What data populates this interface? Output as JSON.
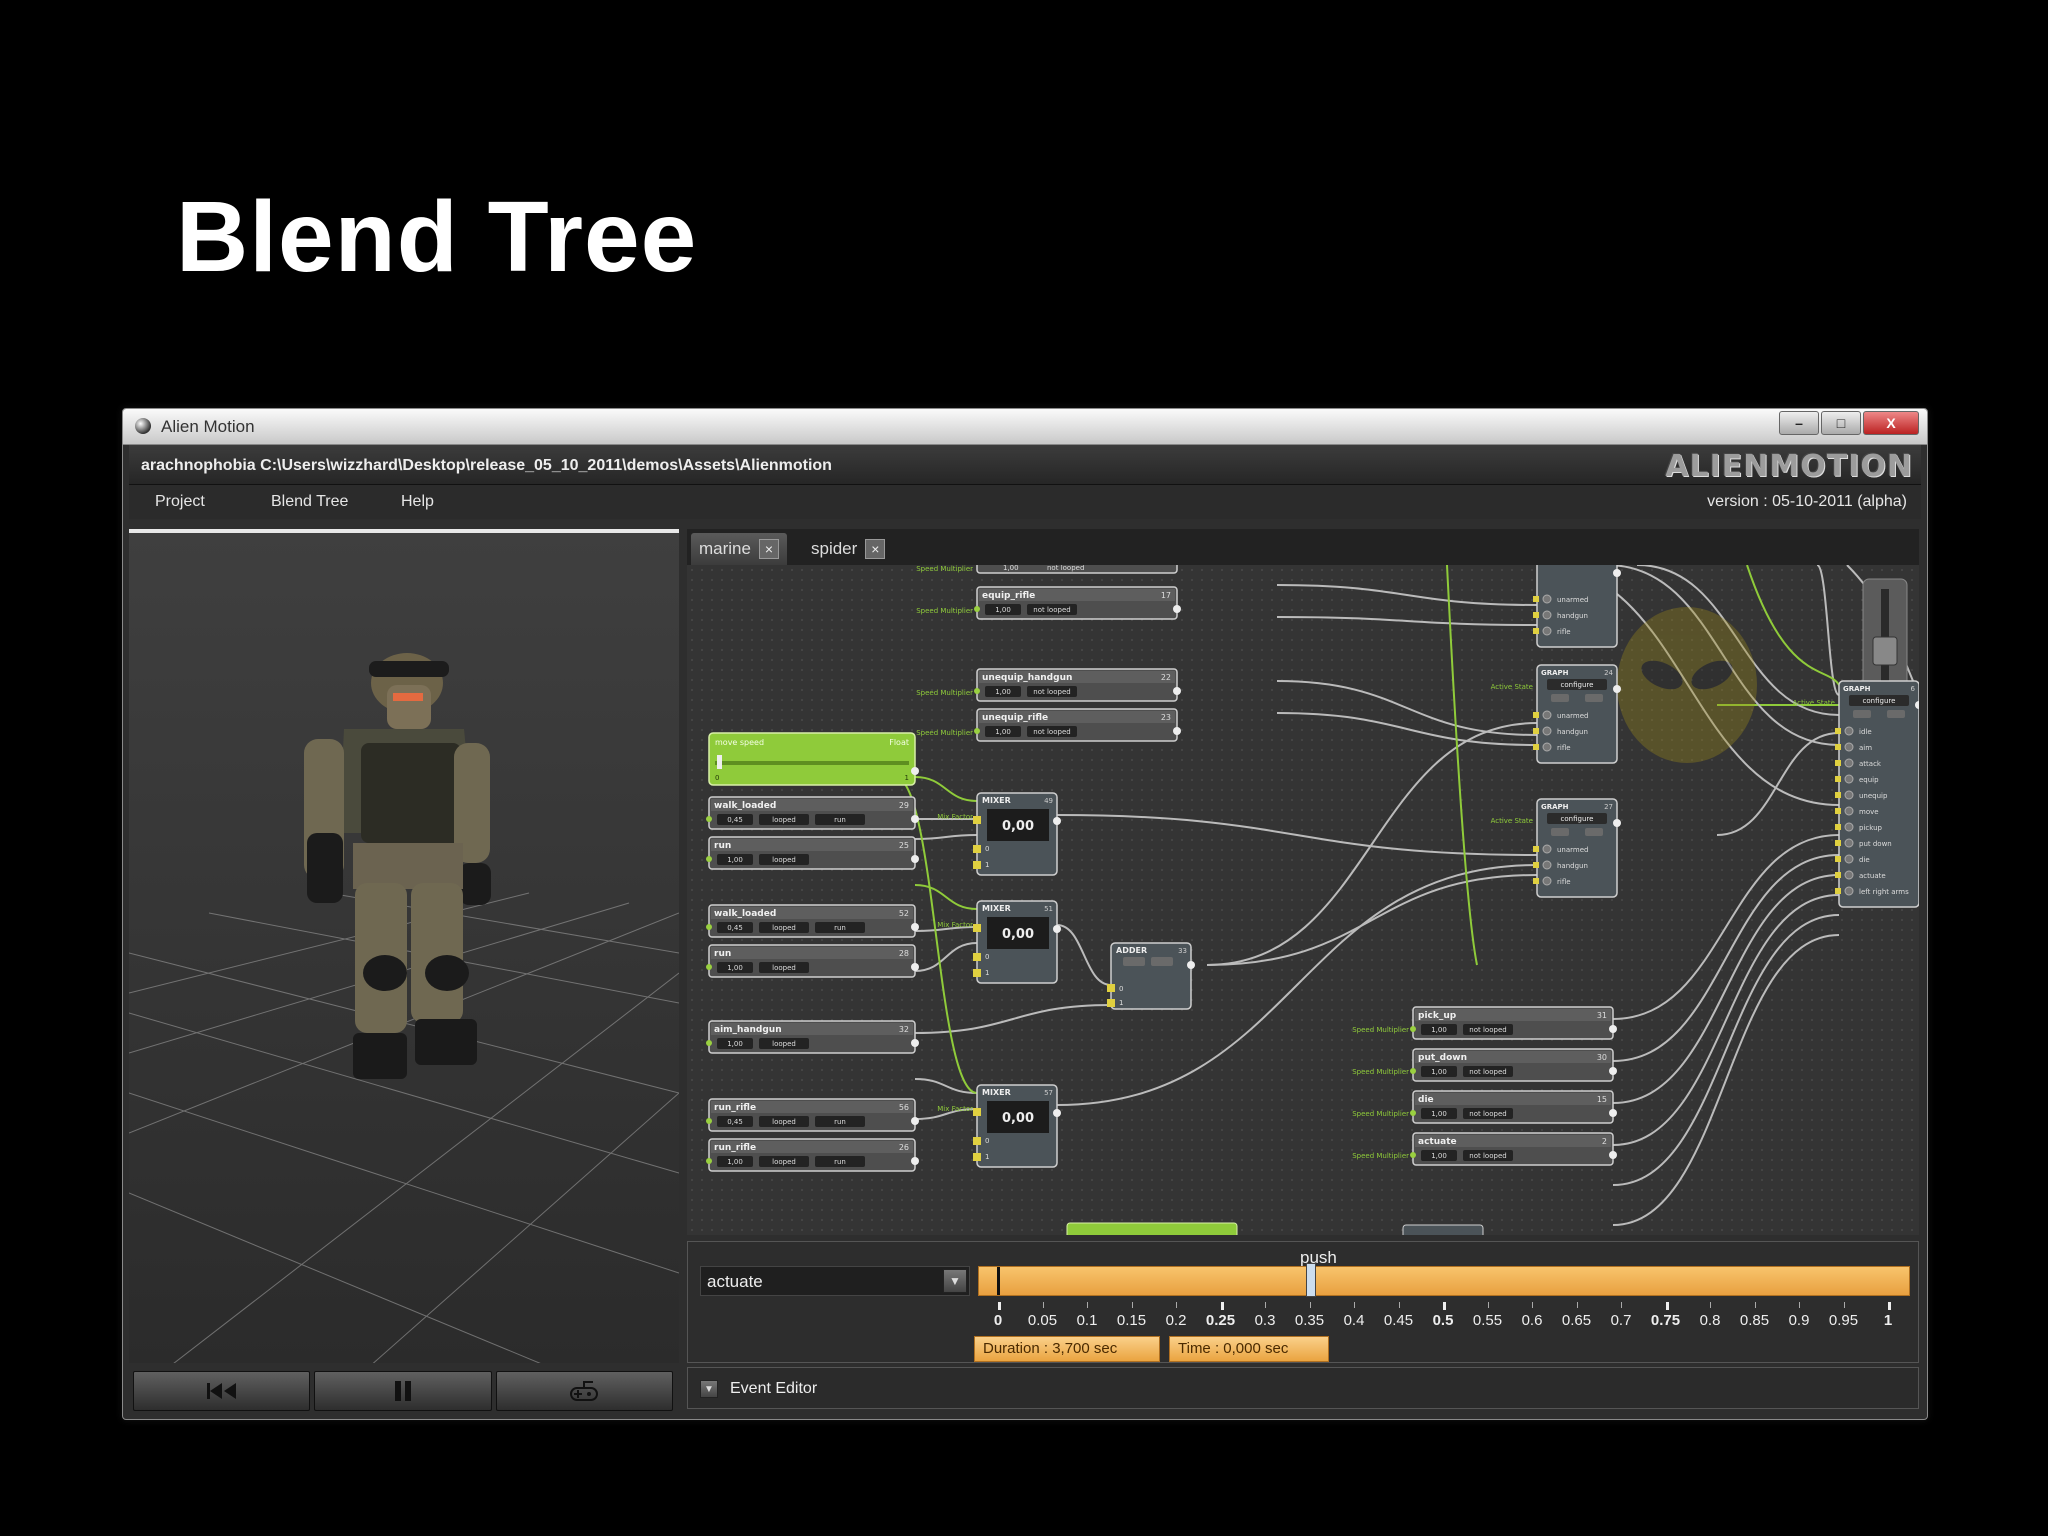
{
  "slide": {
    "title": "Blend Tree"
  },
  "window": {
    "title": "Alien Motion",
    "controls": {
      "minimize": "–",
      "maximize": "□",
      "close": "X"
    },
    "project_name": "arachnophobia",
    "project_path": "C:\\Users\\wizzhard\\Desktop\\release_05_10_2011\\demos\\Assets\\Alienmotion",
    "logo": "ALIENMOTION",
    "version": "version : 05-10-2011 (alpha)"
  },
  "menu": [
    "Project",
    "Blend Tree",
    "Help"
  ],
  "tabs": [
    {
      "label": "marine",
      "close": "×",
      "active": true
    },
    {
      "label": "spider",
      "close": "×",
      "active": false
    }
  ],
  "graph": {
    "param_node": {
      "title": "move speed",
      "type": "Float",
      "min": "0",
      "max": "1"
    },
    "clip_nodes": [
      {
        "name": "walk_loaded",
        "id": "29",
        "speed": "0,45",
        "loop": "looped",
        "extra": "run"
      },
      {
        "name": "run",
        "id": "25",
        "speed": "1,00",
        "loop": "looped",
        "extra": ""
      },
      {
        "name": "walk_loaded",
        "id": "52",
        "speed": "0,45",
        "loop": "looped",
        "extra": "run"
      },
      {
        "name": "run",
        "id": "28",
        "speed": "1,00",
        "loop": "looped",
        "extra": ""
      },
      {
        "name": "aim_handgun",
        "id": "32",
        "speed": "1,00",
        "loop": "looped",
        "extra": ""
      },
      {
        "name": "run_rifle",
        "id": "56",
        "speed": "0,45",
        "loop": "looped",
        "extra": "run"
      },
      {
        "name": "run_rifle",
        "id": "26",
        "speed": "1,00",
        "loop": "looped",
        "extra": "run"
      }
    ],
    "top_clips": [
      {
        "name": "equip_rifle",
        "id": "17",
        "speed": "1,00",
        "loop": "not looped"
      },
      {
        "name": "unequip_handgun",
        "id": "22",
        "speed": "1,00",
        "loop": "not looped"
      },
      {
        "name": "unequip_rifle",
        "id": "23",
        "speed": "1,00",
        "loop": "not looped"
      }
    ],
    "right_clips": [
      {
        "name": "pick_up",
        "id": "31",
        "speed": "1,00",
        "loop": "not looped"
      },
      {
        "name": "put_down",
        "id": "30",
        "speed": "1,00",
        "loop": "not looped"
      },
      {
        "name": "die",
        "id": "15",
        "speed": "1,00",
        "loop": "not looped"
      },
      {
        "name": "actuate",
        "id": "2",
        "speed": "1,00",
        "loop": "not looped"
      }
    ],
    "mixers": [
      {
        "title": "MIXER",
        "id": "49",
        "value": "0,00"
      },
      {
        "title": "MIXER",
        "id": "51",
        "value": "0,00"
      },
      {
        "title": "MIXER",
        "id": "57",
        "value": "0,00"
      }
    ],
    "adder": {
      "title": "ADDER",
      "id": "33"
    },
    "graph_nodes": [
      {
        "title": "GRAPH",
        "id": "24",
        "button": "configure",
        "slots": [
          "unarmed",
          "handgun",
          "rifle"
        ]
      },
      {
        "title": "GRAPH",
        "id": "27",
        "button": "configure",
        "slots": [
          "unarmed",
          "handgun",
          "rifle"
        ]
      }
    ],
    "top_graph_slots": [
      "unarmed",
      "handgun",
      "rifle"
    ],
    "main_graph": {
      "title": "GRAPH",
      "id": "6",
      "button": "configure",
      "slots": [
        "idle",
        "aim",
        "attack",
        "equip",
        "unequip",
        "move",
        "pickup",
        "put down",
        "die",
        "actuate",
        "left right arms"
      ]
    },
    "labels": {
      "speed_multiplier": "Speed Multiplier",
      "mix_factor": "Mix Factor",
      "active_state": "Active State",
      "top_value": "1,00",
      "top_loop": "not looped"
    }
  },
  "timeline": {
    "clip_label": "push",
    "selected_clip": "actuate",
    "ticks": [
      "0",
      "0.05",
      "0.1",
      "0.15",
      "0.2",
      "0.25",
      "0.3",
      "0.35",
      "0.4",
      "0.45",
      "0.5",
      "0.55",
      "0.6",
      "0.65",
      "0.7",
      "0.75",
      "0.8",
      "0.85",
      "0.9",
      "0.95",
      "1"
    ],
    "cursor_position": 0.35,
    "duration": "Duration :  3,700 sec",
    "time": "Time :  0,000 sec"
  },
  "event_editor": {
    "label": "Event Editor"
  },
  "colors": {
    "accent_green": "#8fcb3a",
    "timeline_orange": "#f2b456",
    "background": "#000000"
  },
  "icons": [
    "rewind-icon",
    "pause-icon",
    "gamepad-icon",
    "alien-head-icon"
  ]
}
